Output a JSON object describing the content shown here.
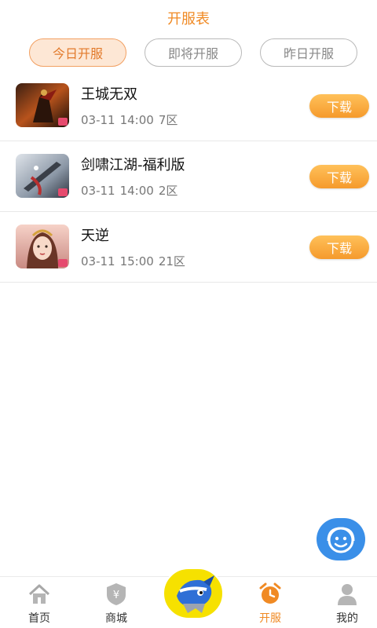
{
  "header": {
    "title": "开服表"
  },
  "tabs": [
    {
      "label": "今日开服",
      "active": true
    },
    {
      "label": "即将开服",
      "active": false
    },
    {
      "label": "昨日开服",
      "active": false
    }
  ],
  "games": [
    {
      "name": "王城无双",
      "date": "03-11",
      "time": "14:00",
      "zone": "7区",
      "button": "下载"
    },
    {
      "name": "剑啸江湖-福利版",
      "date": "03-11",
      "time": "14:00",
      "zone": "2区",
      "button": "下载"
    },
    {
      "name": "天逆",
      "date": "03-11",
      "time": "15:00",
      "zone": "21区",
      "button": "下载"
    }
  ],
  "bottom_nav": [
    {
      "label": "首页",
      "icon": "home-icon"
    },
    {
      "label": "商城",
      "icon": "shop-icon"
    },
    {
      "label": "",
      "icon": "mascot-icon"
    },
    {
      "label": "开服",
      "icon": "alarm-clock-icon",
      "active": true
    },
    {
      "label": "我的",
      "icon": "user-icon"
    }
  ],
  "colors": {
    "accent": "#f08a24",
    "fab": "#3a8fe8",
    "button_start": "#ffc15a",
    "button_end": "#f59a2c"
  }
}
